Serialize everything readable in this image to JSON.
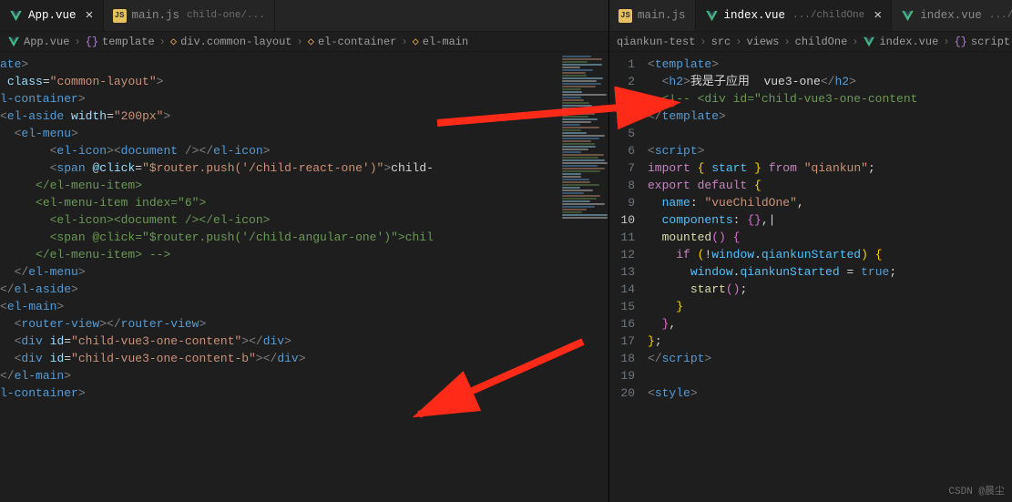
{
  "left": {
    "tabs": [
      {
        "icon": "vue",
        "label": "App.vue",
        "active": true,
        "close": true
      },
      {
        "icon": "js",
        "label": "main.js",
        "desc": "child-one/...",
        "active": false
      }
    ],
    "crumbs": [
      {
        "icon": "vue",
        "text": "App.vue"
      },
      {
        "icon": "brace",
        "text": "template"
      },
      {
        "icon": "sym",
        "text": "div.common-layout"
      },
      {
        "icon": "sym",
        "text": "el-container"
      },
      {
        "icon": "sym",
        "text": "el-main"
      }
    ],
    "code": [
      [
        [
          "t-name",
          "ate"
        ],
        [
          "t-tag",
          ">"
        ]
      ],
      [
        [
          "t-pun",
          " "
        ],
        [
          "t-attr",
          "class"
        ],
        [
          "t-pun",
          "="
        ],
        [
          "t-str",
          "\"common-layout\""
        ],
        [
          "t-tag",
          ">"
        ]
      ],
      [
        [
          "t-name",
          "l-container"
        ],
        [
          "t-tag",
          ">"
        ]
      ],
      [
        [
          "t-tag",
          "<"
        ],
        [
          "t-name",
          "el-aside"
        ],
        [
          "t-pun",
          " "
        ],
        [
          "t-attr",
          "width"
        ],
        [
          "t-pun",
          "="
        ],
        [
          "t-str",
          "\"200px\""
        ],
        [
          "t-tag",
          ">"
        ]
      ],
      [
        [
          "t-pun",
          "  "
        ],
        [
          "t-tag",
          "<"
        ],
        [
          "t-name",
          "el-menu"
        ],
        [
          "t-tag",
          ">"
        ]
      ],
      [
        [
          "",
          "       "
        ],
        [
          "t-tag",
          "<"
        ],
        [
          "t-name",
          "el-icon"
        ],
        [
          "t-tag",
          "><"
        ],
        [
          "t-name",
          "document"
        ],
        [
          "t-tag",
          " /></"
        ],
        [
          "t-name",
          "el-icon"
        ],
        [
          "t-tag",
          ">"
        ]
      ],
      [
        [
          "",
          "       "
        ],
        [
          "t-tag",
          "<"
        ],
        [
          "t-name",
          "span"
        ],
        [
          "t-pun",
          " "
        ],
        [
          "t-attr",
          "@click"
        ],
        [
          "t-pun",
          "="
        ],
        [
          "t-str",
          "\"$router.push('/child-react-one')\""
        ],
        [
          "t-tag",
          ">"
        ],
        [
          "t-pun",
          "child-"
        ]
      ],
      [
        [
          "",
          "     "
        ],
        [
          "t-cmt",
          "</el-menu-item>"
        ]
      ],
      [
        [
          "",
          "     "
        ],
        [
          "t-cmt",
          "<el-menu-item index=\"6\">"
        ]
      ],
      [
        [
          "",
          "       "
        ],
        [
          "t-cmt",
          "<el-icon><document /></el-icon>"
        ]
      ],
      [
        [
          "",
          "       "
        ],
        [
          "t-cmt",
          "<span @click=\"$router.push('/child-angular-one')\">chil"
        ]
      ],
      [
        [
          "",
          "     "
        ],
        [
          "t-cmt",
          "</el-menu-item> -->"
        ]
      ],
      [
        [
          "",
          "  "
        ],
        [
          "t-tag",
          "</"
        ],
        [
          "t-name",
          "el-menu"
        ],
        [
          "t-tag",
          ">"
        ]
      ],
      [
        [
          "t-tag",
          "</"
        ],
        [
          "t-name",
          "el-aside"
        ],
        [
          "t-tag",
          ">"
        ]
      ],
      [
        [
          "t-tag",
          "<"
        ],
        [
          "t-name",
          "el-main"
        ],
        [
          "t-tag",
          ">"
        ]
      ],
      [
        [
          "",
          "  "
        ],
        [
          "t-tag",
          "<"
        ],
        [
          "t-name",
          "router-view"
        ],
        [
          "t-tag",
          "></"
        ],
        [
          "t-name",
          "router-view"
        ],
        [
          "t-tag",
          ">"
        ]
      ],
      [
        [
          "",
          "  "
        ],
        [
          "t-tag",
          "<"
        ],
        [
          "t-name",
          "div"
        ],
        [
          "t-pun",
          " "
        ],
        [
          "t-attr",
          "id"
        ],
        [
          "t-pun",
          "="
        ],
        [
          "t-str",
          "\"child-vue3-one-content\""
        ],
        [
          "t-tag",
          "></"
        ],
        [
          "t-name",
          "div"
        ],
        [
          "t-tag",
          ">"
        ]
      ],
      [
        [
          "",
          "  "
        ],
        [
          "t-tag",
          "<"
        ],
        [
          "t-name",
          "div"
        ],
        [
          "t-pun",
          " "
        ],
        [
          "t-attr",
          "id"
        ],
        [
          "t-pun",
          "="
        ],
        [
          "t-str",
          "\"child-vue3-one-content-b\""
        ],
        [
          "t-tag",
          "></"
        ],
        [
          "t-name",
          "div"
        ],
        [
          "t-tag",
          ">"
        ]
      ],
      [
        [
          "t-tag",
          "</"
        ],
        [
          "t-name",
          "el-main"
        ],
        [
          "t-tag",
          ">"
        ]
      ],
      [
        [
          "t-name",
          "l-container"
        ],
        [
          "t-tag",
          ">"
        ]
      ]
    ]
  },
  "right": {
    "tabs": [
      {
        "icon": "js",
        "label": "main.js",
        "active": false
      },
      {
        "icon": "vue",
        "label": "index.vue",
        "desc": ".../childOne",
        "active": true,
        "close": true
      },
      {
        "icon": "vue",
        "label": "index.vue",
        "desc": ".../childO",
        "active": false
      }
    ],
    "crumbs": [
      {
        "text": "qiankun-test"
      },
      {
        "text": "src"
      },
      {
        "text": "views"
      },
      {
        "text": "childOne"
      },
      {
        "icon": "vue",
        "text": "index.vue"
      },
      {
        "icon": "brace",
        "text": "script"
      },
      {
        "icon": "sym",
        "text": ""
      }
    ],
    "lines": [
      "1",
      "2",
      "3",
      "4",
      "5",
      "6",
      "7",
      "8",
      "9",
      "10",
      "11",
      "12",
      "13",
      "14",
      "15",
      "16",
      "17",
      "18",
      "19",
      "20"
    ],
    "cursor_line": 10,
    "code": [
      [
        [
          "t-tag",
          "<"
        ],
        [
          "t-name",
          "template"
        ],
        [
          "t-tag",
          ">"
        ]
      ],
      [
        [
          "",
          "  "
        ],
        [
          "t-tag",
          "<"
        ],
        [
          "t-name",
          "h2"
        ],
        [
          "t-tag",
          ">"
        ],
        [
          "t-pun",
          "我是子应用  vue3-one"
        ],
        [
          "t-tag",
          "</"
        ],
        [
          "t-name",
          "h2"
        ],
        [
          "t-tag",
          ">"
        ]
      ],
      [
        [
          "",
          "  "
        ],
        [
          "t-cmt",
          "<!-- <div id=\"child-vue3-one-content"
        ]
      ],
      [
        [
          "t-tag",
          "</"
        ],
        [
          "t-name",
          "template"
        ],
        [
          "t-tag",
          ">"
        ]
      ],
      [
        [
          "",
          ""
        ]
      ],
      [
        [
          "t-tag",
          "<"
        ],
        [
          "t-name",
          "script"
        ],
        [
          "t-tag",
          ">"
        ]
      ],
      [
        [
          "t-key",
          "import"
        ],
        [
          "",
          " "
        ],
        [
          "t-brk",
          "{"
        ],
        [
          "",
          " "
        ],
        [
          "t-id",
          "start"
        ],
        [
          "",
          " "
        ],
        [
          "t-brk",
          "}"
        ],
        [
          "",
          " "
        ],
        [
          "t-key",
          "from"
        ],
        [
          "",
          " "
        ],
        [
          "t-str",
          "\"qiankun\""
        ],
        [
          "t-pun",
          ";"
        ]
      ],
      [
        [
          "t-key",
          "export"
        ],
        [
          "",
          " "
        ],
        [
          "t-key",
          "default"
        ],
        [
          "",
          " "
        ],
        [
          "t-brk",
          "{"
        ]
      ],
      [
        [
          "",
          "  "
        ],
        [
          "t-id",
          "name"
        ],
        [
          "t-pun",
          ":"
        ],
        [
          "",
          " "
        ],
        [
          "t-str",
          "\"vueChildOne\""
        ],
        [
          "t-pun",
          ","
        ]
      ],
      [
        [
          "",
          "  "
        ],
        [
          "t-id",
          "components"
        ],
        [
          "t-pun",
          ":"
        ],
        [
          "",
          " "
        ],
        [
          "t-brk2",
          "{}"
        ],
        [
          "t-pun",
          ","
        ],
        [
          "t-pun",
          "|"
        ]
      ],
      [
        [
          "",
          "  "
        ],
        [
          "t-fn",
          "mounted"
        ],
        [
          "t-brk2",
          "()"
        ],
        [
          "",
          " "
        ],
        [
          "t-brk2",
          "{"
        ]
      ],
      [
        [
          "",
          "    "
        ],
        [
          "t-key",
          "if"
        ],
        [
          "",
          " "
        ],
        [
          "t-brk",
          "("
        ],
        [
          "t-pun",
          "!"
        ],
        [
          "t-id",
          "window"
        ],
        [
          "t-pun",
          "."
        ],
        [
          "t-id",
          "qiankunStarted"
        ],
        [
          "t-brk",
          ")"
        ],
        [
          "",
          " "
        ],
        [
          "t-brk",
          "{"
        ]
      ],
      [
        [
          "",
          "      "
        ],
        [
          "t-id",
          "window"
        ],
        [
          "t-pun",
          "."
        ],
        [
          "t-id",
          "qiankunStarted"
        ],
        [
          "",
          " "
        ],
        [
          "t-pun",
          "="
        ],
        [
          "",
          " "
        ],
        [
          "t-lit",
          "true"
        ],
        [
          "t-pun",
          ";"
        ]
      ],
      [
        [
          "",
          "      "
        ],
        [
          "t-fn",
          "start"
        ],
        [
          "t-brk2",
          "()"
        ],
        [
          "t-pun",
          ";"
        ]
      ],
      [
        [
          "",
          "    "
        ],
        [
          "t-brk",
          "}"
        ]
      ],
      [
        [
          "",
          "  "
        ],
        [
          "t-brk2",
          "}"
        ],
        [
          "t-pun",
          ","
        ]
      ],
      [
        [
          "t-brk",
          "}"
        ],
        [
          "t-pun",
          ";"
        ]
      ],
      [
        [
          "t-tag",
          "</"
        ],
        [
          "t-name",
          "script"
        ],
        [
          "t-tag",
          ">"
        ]
      ],
      [
        [
          "",
          ""
        ]
      ],
      [
        [
          "t-tag",
          "<"
        ],
        [
          "t-name",
          "style"
        ],
        [
          "t-tag",
          ">"
        ]
      ]
    ]
  },
  "watermark": "CSDN @晨尘"
}
